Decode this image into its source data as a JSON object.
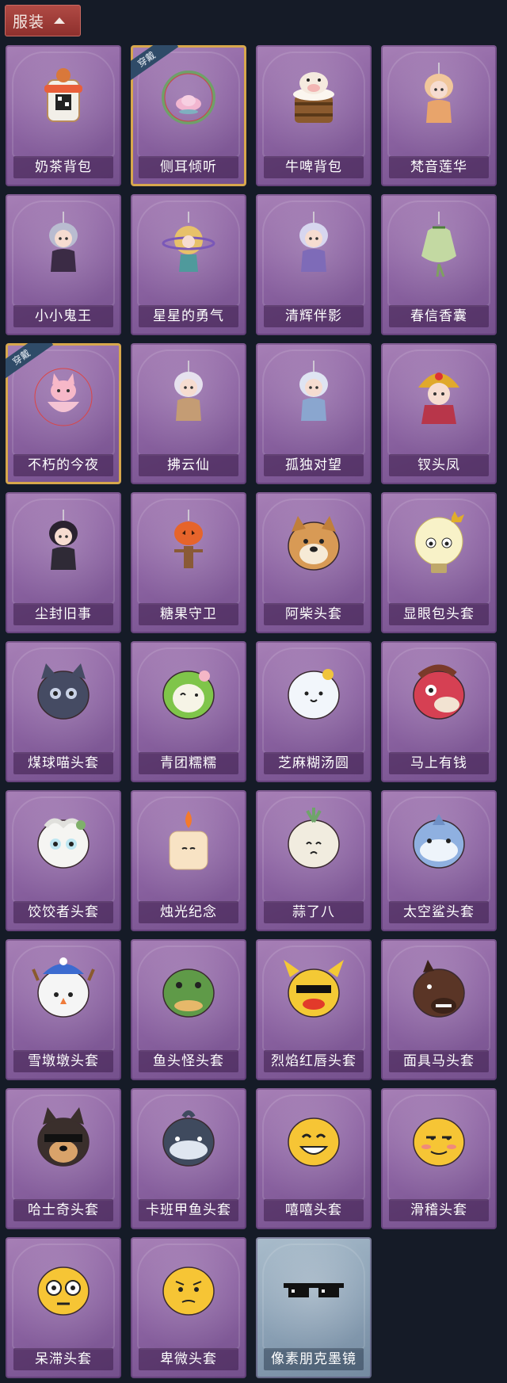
{
  "header": {
    "label": "服装"
  },
  "worn_label": "穿戴",
  "items": [
    {
      "label": "奶茶背包",
      "icon": "milk-tea-backpack-icon",
      "worn": false
    },
    {
      "label": "侧耳倾听",
      "icon": "flower-wreath-icon",
      "worn": true
    },
    {
      "label": "牛啤背包",
      "icon": "cow-beer-backpack-icon",
      "worn": false
    },
    {
      "label": "梵音莲华",
      "icon": "lotus-doll-icon",
      "worn": false
    },
    {
      "label": "小小鬼王",
      "icon": "ghost-king-doll-icon",
      "worn": false
    },
    {
      "label": "星星的勇气",
      "icon": "star-planet-doll-icon",
      "worn": false
    },
    {
      "label": "清辉伴影",
      "icon": "moon-spirit-doll-icon",
      "worn": false
    },
    {
      "label": "春信香囊",
      "icon": "sachet-icon",
      "worn": false
    },
    {
      "label": "不朽的今夜",
      "icon": "fox-teacup-icon",
      "worn": true
    },
    {
      "label": "拂云仙",
      "icon": "cloud-immortal-doll-icon",
      "worn": false
    },
    {
      "label": "孤独对望",
      "icon": "lonely-gaze-doll-icon",
      "worn": false
    },
    {
      "label": "钗头凤",
      "icon": "phoenix-crown-doll-icon",
      "worn": false
    },
    {
      "label": "尘封旧事",
      "icon": "old-story-doll-icon",
      "worn": false
    },
    {
      "label": "糖果守卫",
      "icon": "pumpkin-guard-icon",
      "worn": false
    },
    {
      "label": "阿柴头套",
      "icon": "shiba-head-icon",
      "worn": false
    },
    {
      "label": "显眼包头套",
      "icon": "lightbulb-head-icon",
      "worn": false
    },
    {
      "label": "煤球喵头套",
      "icon": "black-cat-head-icon",
      "worn": false
    },
    {
      "label": "青团糯糯",
      "icon": "green-mochi-head-icon",
      "worn": false
    },
    {
      "label": "芝麻糊汤圆",
      "icon": "tangyuan-head-icon",
      "worn": false
    },
    {
      "label": "马上有钱",
      "icon": "red-horse-head-icon",
      "worn": false
    },
    {
      "label": "饺饺者头套",
      "icon": "dumpling-head-icon",
      "worn": false
    },
    {
      "label": "烛光纪念",
      "icon": "candle-head-icon",
      "worn": false
    },
    {
      "label": "蒜了八",
      "icon": "garlic-head-icon",
      "worn": false
    },
    {
      "label": "太空鲨头套",
      "icon": "space-shark-head-icon",
      "worn": false
    },
    {
      "label": "雪墩墩头套",
      "icon": "snow-deer-head-icon",
      "worn": false
    },
    {
      "label": "鱼头怪头套",
      "icon": "fish-monster-head-icon",
      "worn": false
    },
    {
      "label": "烈焰红唇头套",
      "icon": "yellow-lips-head-icon",
      "worn": false
    },
    {
      "label": "面具马头套",
      "icon": "horse-mask-head-icon",
      "worn": false
    },
    {
      "label": "哈士奇头套",
      "icon": "husky-head-icon",
      "worn": false
    },
    {
      "label": "卡班甲鱼头套",
      "icon": "catfish-head-icon",
      "worn": false
    },
    {
      "label": "嘻嘻头套",
      "icon": "grin-emoji-head-icon",
      "worn": false
    },
    {
      "label": "滑稽头套",
      "icon": "smirk-emoji-head-icon",
      "worn": false
    },
    {
      "label": "呆滞头套",
      "icon": "dazed-emoji-head-icon",
      "worn": false
    },
    {
      "label": "卑微头套",
      "icon": "humble-emoji-head-icon",
      "worn": false
    },
    {
      "label": "像素朋克墨镜",
      "icon": "pixel-sunglasses-icon",
      "worn": false,
      "tier": "blue"
    }
  ],
  "colors": {
    "purple_card": "#8d64a3",
    "blue_card": "#8ca2b6",
    "worn_border": "#d7a74c",
    "header_bg": "#a0403b"
  }
}
